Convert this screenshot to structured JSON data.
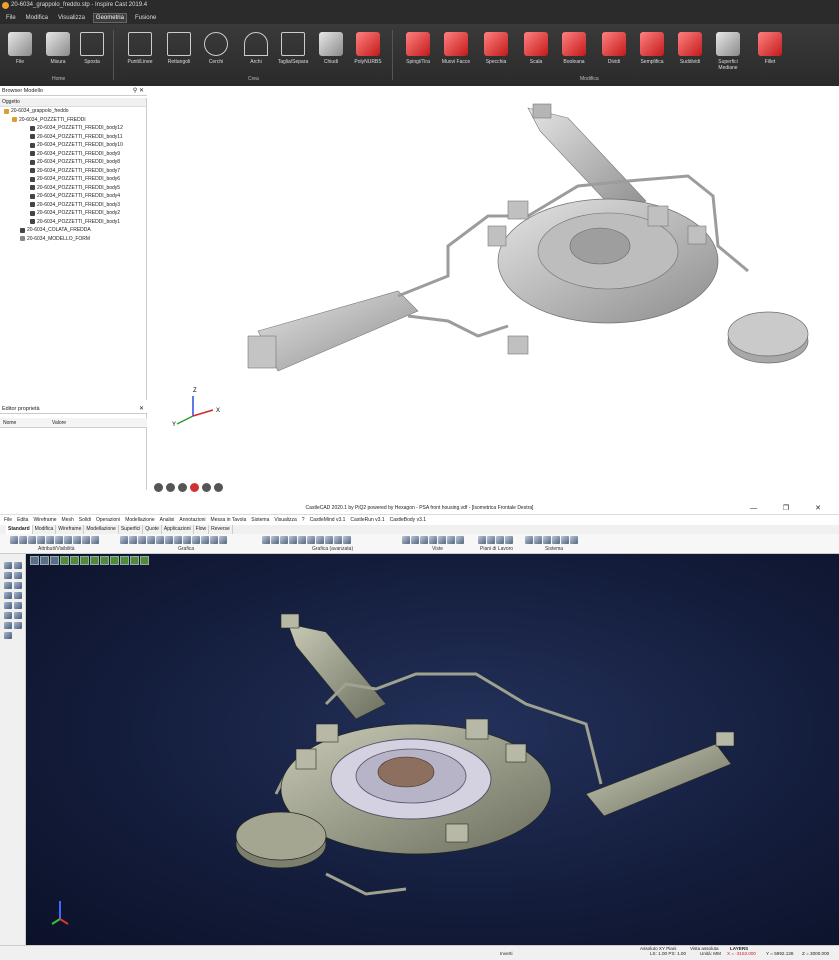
{
  "top": {
    "title": "20-6034_grappolo_freddo.stp - Inspire Cast 2019.4",
    "menu": [
      "File",
      "Modifica",
      "Visualizza",
      "Geometria",
      "Fusione"
    ],
    "menu_active": "Geometria",
    "ribbon": {
      "buttons": [
        "File",
        "Misura",
        "Sposta",
        "Punti/Linee",
        "Rettangoli",
        "Cerchi",
        "Archi",
        "Taglia/Separa",
        "Chiudi",
        "PolyNURBS",
        "Spingi/Tira",
        "Muovi Facce",
        "Specchia",
        "Scala",
        "Booleana",
        "Dividi",
        "Semplifica",
        "Suddividi",
        "Superfici Mediane",
        "Fillet"
      ],
      "groups": {
        "home": "Home",
        "crea": "Crea",
        "modifica": "Modifica"
      }
    },
    "browser": {
      "title": "Browser Modello",
      "column": "Oggetto",
      "root": "20-6034_grappolo_freddo",
      "group": "20-6034_POZZETTI_FREDDI",
      "bodies": [
        "20-6034_POZZETTI_FREDDI_body12",
        "20-6034_POZZETTI_FREDDI_body11",
        "20-6034_POZZETTI_FREDDI_body10",
        "20-6034_POZZETTI_FREDDI_body9",
        "20-6034_POZZETTI_FREDDI_body8",
        "20-6034_POZZETTI_FREDDI_body7",
        "20-6034_POZZETTI_FREDDI_body6",
        "20-6034_POZZETTI_FREDDI_body5",
        "20-6034_POZZETTI_FREDDI_body4",
        "20-6034_POZZETTI_FREDDI_body3",
        "20-6034_POZZETTI_FREDDI_body2",
        "20-6034_POZZETTI_FREDDI_body1"
      ],
      "colata": "20-6034_COLATA_FREDDA",
      "modello": "20-6034_MODELLO_FORM"
    },
    "editor": {
      "title": "Editor proprietà",
      "col_name": "Nome",
      "col_value": "Valore"
    },
    "axes": {
      "x": "X",
      "y": "Y",
      "z": "Z"
    }
  },
  "bottom": {
    "title": "CastleCAD 2020.1 by PiQ2 powered by Hexagon - PSA front housing.vdf - [Isometrica Frontale Destra]",
    "window_controls": "— ❐ ✕",
    "menu": [
      "File",
      "Edita",
      "Wireframe",
      "Mesh",
      "Solidi",
      "Operazioni",
      "Modellazione",
      "Analisi",
      "Annotazioni",
      "Messa in Tavola",
      "Sistema",
      "Visualizza",
      "?",
      "CastleMind v3.1",
      "CastleRun v3.1",
      "CastleBody v3.1"
    ],
    "tabs": [
      "Standard",
      "Modifica",
      "Wireframe",
      "Modellazione",
      "Superfici",
      "Quote",
      "Applicazioni",
      "Flow",
      "Reverse"
    ],
    "tabs_active": "Standard",
    "toolbar_labels": [
      "Attributi/Visibilità",
      "Grafica",
      "Grafica (avanzata)",
      "Viste",
      "Piani di Lavoro",
      "Sistema"
    ],
    "status": {
      "invert": "Inverti",
      "ls": "LS: 1.00 PS: 1.00",
      "units": "Unità: MM",
      "coords_x": "X = -3153.000",
      "coords_y": "Y = 5992.138",
      "coords_z": "Z = 3000.000",
      "snap": "Assoluto XY Piani",
      "view": "Vista assoluta",
      "layers": "LAYERS"
    }
  }
}
